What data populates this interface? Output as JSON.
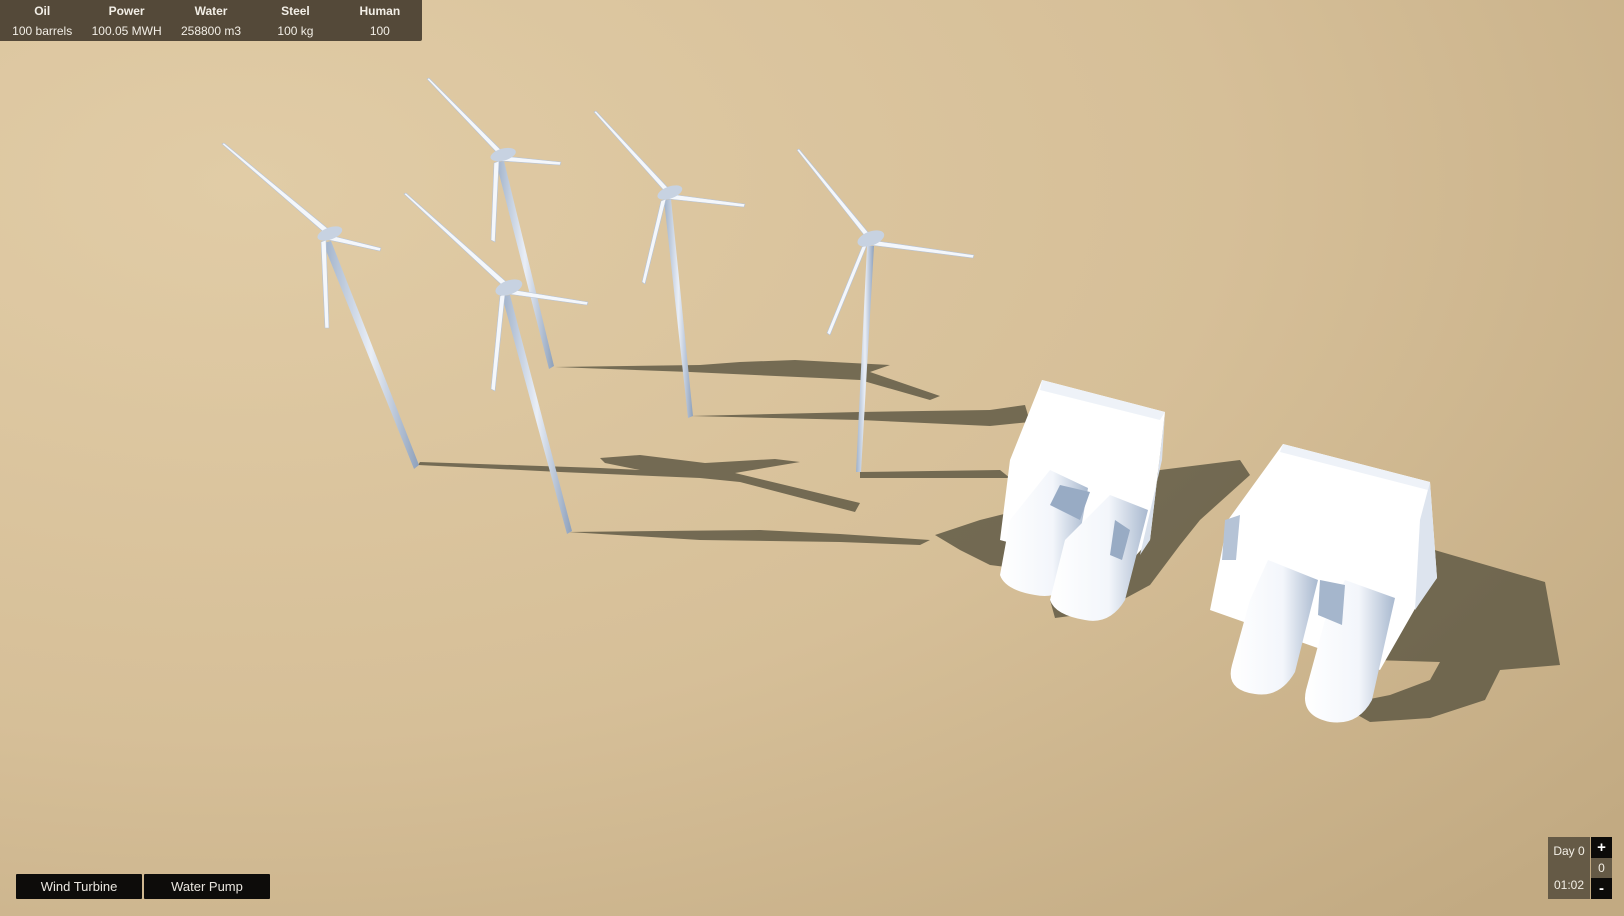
{
  "resources": [
    {
      "name": "Oil",
      "value": "100 barrels"
    },
    {
      "name": "Power",
      "value": "100.05 MWH"
    },
    {
      "name": "Water",
      "value": "258800 m3"
    },
    {
      "name": "Steel",
      "value": "100 kg"
    },
    {
      "name": "Human",
      "value": "100"
    }
  ],
  "build_menu": {
    "wind_turbine_label": "Wind Turbine",
    "water_pump_label": "Water Pump"
  },
  "time": {
    "day_label": "Day 0",
    "clock": "01:02",
    "speed": "0",
    "increase_label": "+",
    "decrease_label": "-"
  },
  "scene": {
    "ground_color": "#d8c39c",
    "shadow_color": "#57523f",
    "structure_color": "#ffffff",
    "structure_shade": "#a9b9cf",
    "wind_turbine_count": 5,
    "water_pump_count": 2
  }
}
